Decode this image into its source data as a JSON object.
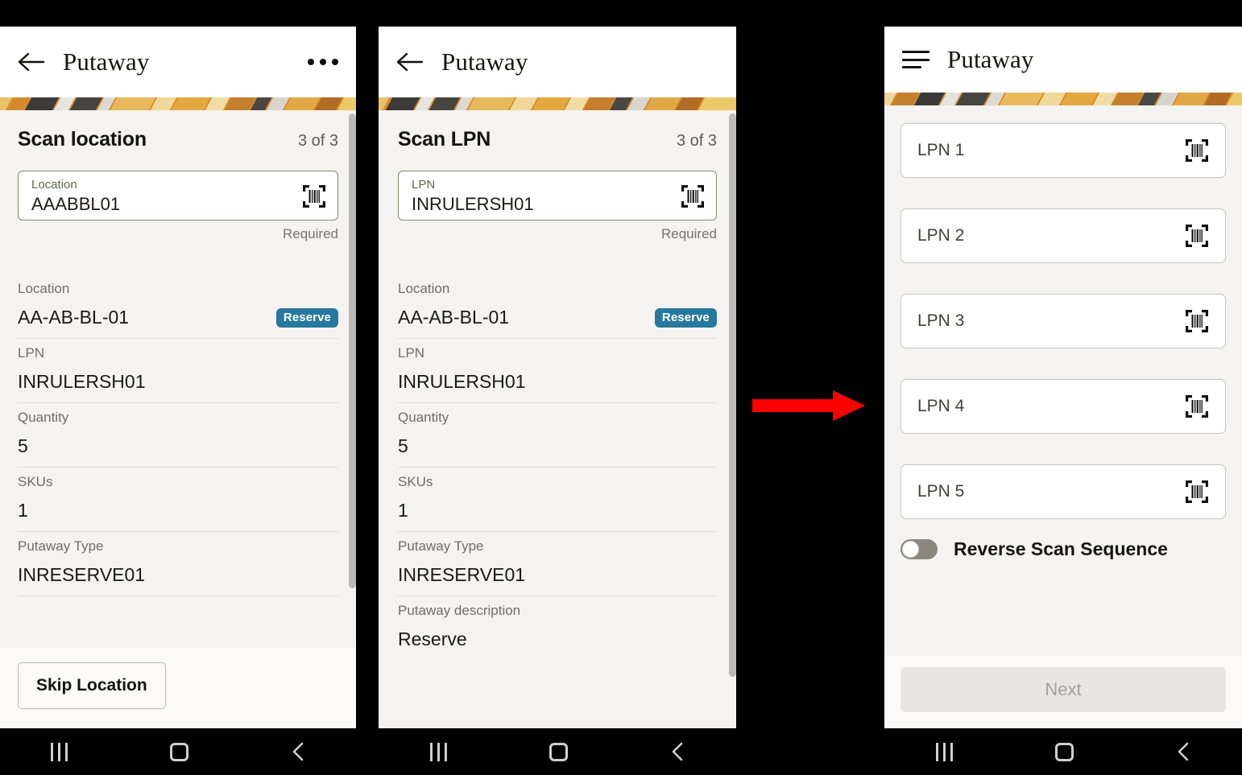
{
  "panels": [
    {
      "id": "scan-location",
      "appbar": {
        "title": "Putaway",
        "back_icon": "back-arrow-icon",
        "menu_icon": "overflow-menu-icon"
      },
      "section": {
        "title": "Scan location",
        "count": "3 of 3"
      },
      "scan_field": {
        "label": "Location",
        "value": "AAABBL01",
        "helper": "Required",
        "icon": "barcode-scan-icon"
      },
      "details": [
        {
          "label": "Location",
          "value": "AA-AB-BL-01",
          "badge": "Reserve"
        },
        {
          "label": "LPN",
          "value": "INRULERSH01",
          "badge": ""
        },
        {
          "label": "Quantity",
          "value": "5",
          "badge": ""
        },
        {
          "label": "SKUs",
          "value": "1",
          "badge": ""
        },
        {
          "label": "Putaway Type",
          "value": "INRESERVE01",
          "badge": ""
        }
      ],
      "footer_button": "Skip Location"
    },
    {
      "id": "scan-lpn",
      "appbar": {
        "title": "Putaway",
        "back_icon": "back-arrow-icon",
        "menu_icon": ""
      },
      "section": {
        "title": "Scan LPN",
        "count": "3 of 3"
      },
      "scan_field": {
        "label": "LPN",
        "value": "INRULERSH01",
        "helper": "Required",
        "icon": "barcode-scan-icon"
      },
      "details": [
        {
          "label": "Location",
          "value": "AA-AB-BL-01",
          "badge": "Reserve"
        },
        {
          "label": "LPN",
          "value": "INRULERSH01",
          "badge": ""
        },
        {
          "label": "Quantity",
          "value": "5",
          "badge": ""
        },
        {
          "label": "SKUs",
          "value": "1",
          "badge": ""
        },
        {
          "label": "Putaway Type",
          "value": "INRESERVE01",
          "badge": ""
        },
        {
          "label": "Putaway description",
          "value": "Reserve",
          "badge": ""
        }
      ],
      "footer_button": ""
    },
    {
      "id": "lpn-list",
      "appbar": {
        "title": "Putaway",
        "back_icon": "hamburger-menu-icon",
        "menu_icon": ""
      },
      "lpn_cards": [
        {
          "label": "LPN 1",
          "icon": "barcode-scan-icon"
        },
        {
          "label": "LPN 2",
          "icon": "barcode-scan-icon"
        },
        {
          "label": "LPN 3",
          "icon": "barcode-scan-icon"
        },
        {
          "label": "LPN 4",
          "icon": "barcode-scan-icon"
        },
        {
          "label": "LPN 5",
          "icon": "barcode-scan-icon"
        }
      ],
      "toggle": {
        "label": "Reverse Scan Sequence",
        "state": "off"
      },
      "next_button": "Next"
    }
  ],
  "nav": {
    "recent_icon": "recent-apps-icon",
    "home_icon": "home-icon",
    "back_icon": "back-icon"
  },
  "annotation": {
    "arrow_icon": "red-right-arrow",
    "arrow_color": "#FF0000"
  },
  "colors": {
    "badge": "#27789E",
    "field_border_focus": "#7C8F63",
    "field_label": "#5C6B46",
    "page_bg": "#F4F3F1",
    "appbar_bg": "#FFFFFF"
  }
}
